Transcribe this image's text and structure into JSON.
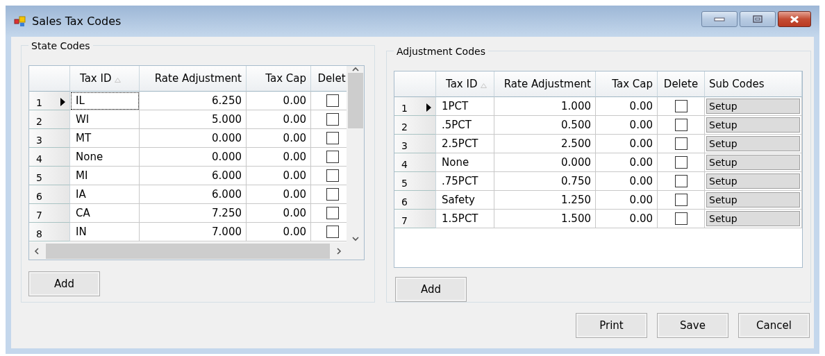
{
  "window": {
    "title": "Sales Tax Codes"
  },
  "state_codes": {
    "title": "State Codes",
    "columns": [
      {
        "label": "Tax ID",
        "sorted": true
      },
      {
        "label": "Rate Adjustment",
        "sorted": false
      },
      {
        "label": "Tax Cap",
        "sorted": false
      },
      {
        "label": "Delet",
        "sorted": false
      }
    ],
    "rows": [
      {
        "number": "1",
        "current": true,
        "tax_id": "IL",
        "rate": "6.250",
        "cap": "0.00",
        "delete": false
      },
      {
        "number": "2",
        "current": false,
        "tax_id": "WI",
        "rate": "5.000",
        "cap": "0.00",
        "delete": false
      },
      {
        "number": "3",
        "current": false,
        "tax_id": "MT",
        "rate": "0.000",
        "cap": "0.00",
        "delete": false
      },
      {
        "number": "4",
        "current": false,
        "tax_id": "None",
        "rate": "0.000",
        "cap": "0.00",
        "delete": false
      },
      {
        "number": "5",
        "current": false,
        "tax_id": "MI",
        "rate": "6.000",
        "cap": "0.00",
        "delete": false
      },
      {
        "number": "6",
        "current": false,
        "tax_id": "IA",
        "rate": "6.000",
        "cap": "0.00",
        "delete": false
      },
      {
        "number": "7",
        "current": false,
        "tax_id": "CA",
        "rate": "7.250",
        "cap": "0.00",
        "delete": false
      },
      {
        "number": "8",
        "current": false,
        "tax_id": "IN",
        "rate": "7.000",
        "cap": "0.00",
        "delete": false
      }
    ],
    "add_button": "Add"
  },
  "adjustment_codes": {
    "title": "Adjustment Codes",
    "columns": [
      {
        "label": "Tax ID",
        "sorted": true
      },
      {
        "label": "Rate Adjustment",
        "sorted": false
      },
      {
        "label": "Tax Cap",
        "sorted": false
      },
      {
        "label": "Delete",
        "sorted": false
      },
      {
        "label": "Sub Codes",
        "sorted": false
      }
    ],
    "rows": [
      {
        "number": "1",
        "current": true,
        "tax_id": "1PCT",
        "rate": "1.000",
        "cap": "0.00",
        "delete": false,
        "sub_codes": "Setup"
      },
      {
        "number": "2",
        "current": false,
        "tax_id": ".5PCT",
        "rate": "0.500",
        "cap": "0.00",
        "delete": false,
        "sub_codes": "Setup"
      },
      {
        "number": "3",
        "current": false,
        "tax_id": "2.5PCT",
        "rate": "2.500",
        "cap": "0.00",
        "delete": false,
        "sub_codes": "Setup"
      },
      {
        "number": "4",
        "current": false,
        "tax_id": "None",
        "rate": "0.000",
        "cap": "0.00",
        "delete": false,
        "sub_codes": "Setup"
      },
      {
        "number": "5",
        "current": false,
        "tax_id": ".75PCT",
        "rate": "0.750",
        "cap": "0.00",
        "delete": false,
        "sub_codes": "Setup"
      },
      {
        "number": "6",
        "current": false,
        "tax_id": "Safety",
        "rate": "1.250",
        "cap": "0.00",
        "delete": false,
        "sub_codes": "Setup"
      },
      {
        "number": "7",
        "current": false,
        "tax_id": "1.5PCT",
        "rate": "1.500",
        "cap": "0.00",
        "delete": false,
        "sub_codes": "Setup"
      }
    ],
    "add_button": "Add"
  },
  "buttons": [
    "Print",
    "Save",
    "Cancel"
  ]
}
